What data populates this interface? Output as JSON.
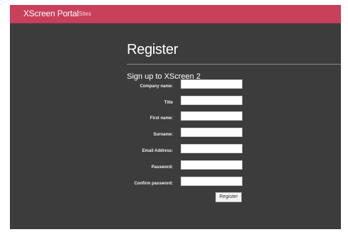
{
  "navbar": {
    "brand": "XScreen Portal",
    "links": [
      "Sites"
    ]
  },
  "page": {
    "title": "Register",
    "subtitle": "Sign up to XScreen 2"
  },
  "form": {
    "fields": [
      {
        "label": "Company name:",
        "value": "",
        "placeholder": ""
      },
      {
        "label": "Title",
        "value": "",
        "placeholder": ""
      },
      {
        "label": "First name:",
        "value": "",
        "placeholder": ""
      },
      {
        "label": "Surname:",
        "value": "",
        "placeholder": ""
      },
      {
        "label": "Email Address:",
        "value": "",
        "placeholder": ""
      },
      {
        "label": "Password:",
        "value": "",
        "placeholder": ""
      },
      {
        "label": "Confirm password:",
        "value": "",
        "placeholder": ""
      }
    ],
    "submit_label": "Register"
  },
  "colors": {
    "navbar": "#c9405a",
    "background": "#3c3c3c",
    "text": "#ffffff"
  }
}
